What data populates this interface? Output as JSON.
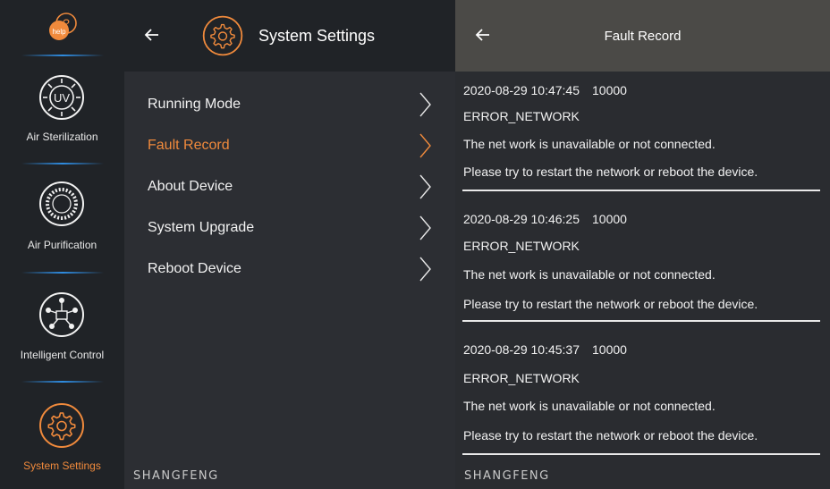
{
  "nav": {
    "help_text": "help",
    "items": [
      {
        "label": "Air Sterilization",
        "icon": "uv-icon"
      },
      {
        "label": "Air Purification",
        "icon": "fan-icon"
      },
      {
        "label": "Intelligent Control",
        "icon": "network-icon"
      },
      {
        "label": "System Settings",
        "icon": "gear-icon",
        "active": true
      }
    ]
  },
  "settings": {
    "title": "System Settings",
    "menu": [
      {
        "label": "Running Mode"
      },
      {
        "label": "Fault Record",
        "active": true
      },
      {
        "label": "About Device"
      },
      {
        "label": "System Upgrade"
      },
      {
        "label": "Reboot Device"
      }
    ],
    "brand": "SHANGFENG"
  },
  "fault_record": {
    "title": "Fault Record",
    "records": [
      {
        "time": "2020-08-29 10:47:45",
        "code": "10000",
        "error": "ERROR_NETWORK",
        "message": "The net work is unavailable or not connected.",
        "advice": "Please try to restart the network or reboot the device."
      },
      {
        "time": "2020-08-29 10:46:25",
        "code": "10000",
        "error": "ERROR_NETWORK",
        "message": "The net work is unavailable or not connected.",
        "advice": "Please try to restart the network or reboot the device."
      },
      {
        "time": "2020-08-29 10:45:37",
        "code": "10000",
        "error": "ERROR_NETWORK",
        "message": "The net work is unavailable or not connected.",
        "advice": "Please try to restart the network or reboot the device."
      }
    ],
    "brand": "SHANGFENG"
  },
  "colors": {
    "accent": "#f08a3c",
    "nav_bg": "#202327",
    "panel_bg": "#2c2e33",
    "header_right": "#4b4a47",
    "separator": "#2f8ce0"
  }
}
